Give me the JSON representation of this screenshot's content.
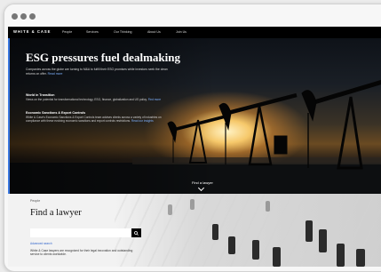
{
  "nav": {
    "logo": "WHITE & CASE",
    "items": [
      "People",
      "Services",
      "Our Thinking",
      "About Us",
      "Join Us"
    ]
  },
  "hero": {
    "title": "ESG pressures fuel dealmaking",
    "intro": "Companies across the globe are turning to M&A to fulfill their ESG promises while investors seek the clean returns on offer.",
    "intro_link": "Read more",
    "sections": [
      {
        "heading": "World in Transition",
        "text": "Views on the potential for transformational technology, ESG, finance, globalization and US policy.",
        "link": "Find more"
      },
      {
        "heading": "Economic Sanctions & Export Controls",
        "text": "White & Case's Economic Sanctions & Export Controls team advises clients across a variety of industries on compliance with these evolving economic sanctions and export controls restrictions.",
        "link": "Read our insights"
      }
    ],
    "cta": "Find a lawyer"
  },
  "find": {
    "eyebrow": "People",
    "title": "Find a lawyer",
    "search_placeholder": "",
    "advanced_link": "Advanced search",
    "description": "White & Case lawyers are recognized for their legal innovation and outstanding service to clients worldwide."
  },
  "colors": {
    "accent": "#3b78e0",
    "nav_bg": "#000000",
    "link": "#7fb2ff"
  }
}
